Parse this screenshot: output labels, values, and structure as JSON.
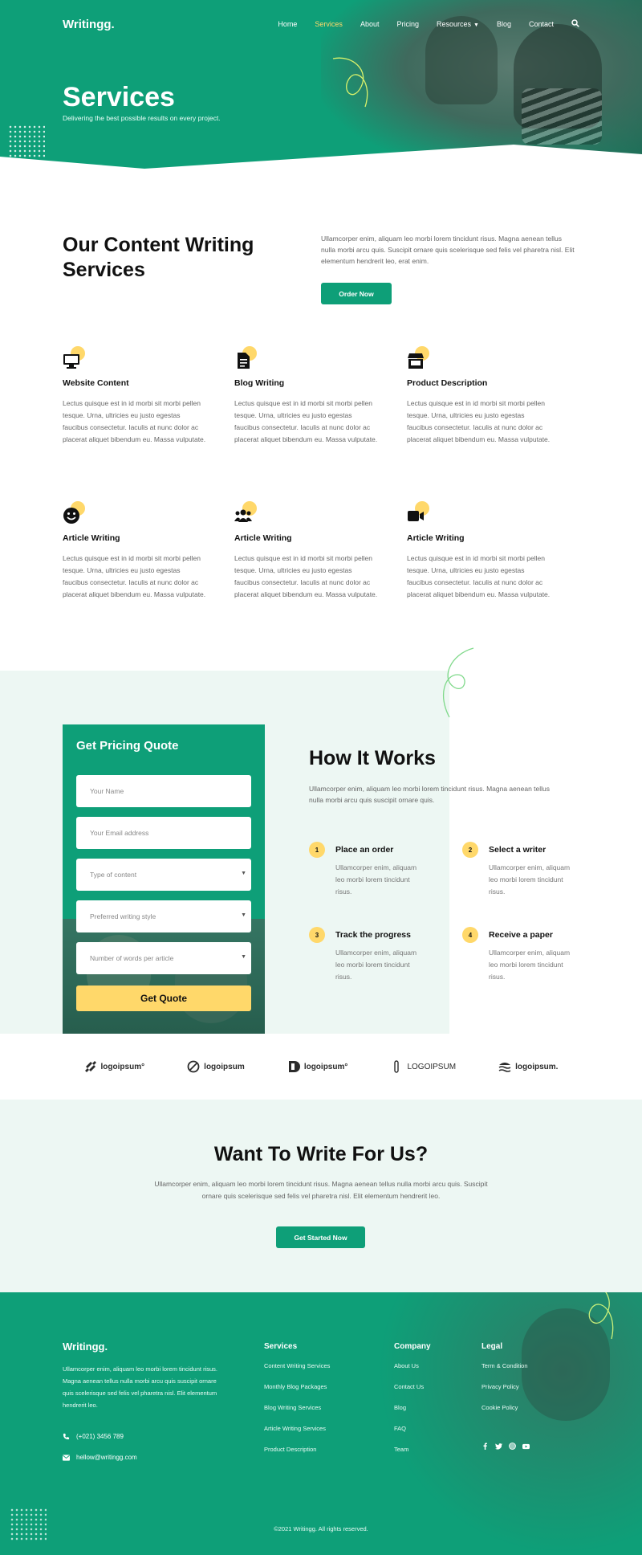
{
  "nav": {
    "logo": "Writingg.",
    "links": [
      "Home",
      "Services",
      "About",
      "Pricing",
      "Resources",
      "Blog",
      "Contact"
    ],
    "active": "Services"
  },
  "hero": {
    "title": "Services",
    "subtitle": "Delivering the best possible results on every project."
  },
  "intro": {
    "heading": "Our Content Writing Services",
    "text": "Ullamcorper enim, aliquam leo morbi lorem tincidunt risus. Magna aenean tellus nulla morbi arcu quis. Suscipit ornare quis scelerisque sed felis vel pharetra nisl. Elit elementum hendrerit leo, erat enim.",
    "button": "Order Now"
  },
  "services": [
    {
      "icon": "monitor-icon",
      "title": "Website Content",
      "text": "Lectus quisque est in id morbi sit morbi pellen tesque. Urna, ultricies eu justo egestas faucibus consectetur. Iaculis at nunc dolor ac placerat aliquet bibendum eu. Massa vulputate."
    },
    {
      "icon": "document-icon",
      "title": "Blog Writing",
      "text": "Lectus quisque est in id morbi sit morbi pellen tesque. Urna, ultricies eu justo egestas faucibus consectetur. Iaculis at nunc dolor ac placerat aliquet bibendum eu. Massa vulputate."
    },
    {
      "icon": "store-icon",
      "title": "Product Description",
      "text": "Lectus quisque est in id morbi sit morbi pellen tesque. Urna, ultricies eu justo egestas faucibus consectetur. Iaculis at nunc dolor ac placerat aliquet bibendum eu. Massa vulputate."
    },
    {
      "icon": "smile-icon",
      "title": "Article Writing",
      "text": "Lectus quisque est in id morbi sit morbi pellen tesque. Urna, ultricies eu justo egestas faucibus consectetur. Iaculis at nunc dolor ac placerat aliquet bibendum eu. Massa vulputate."
    },
    {
      "icon": "users-icon",
      "title": "Article Writing",
      "text": "Lectus quisque est in id morbi sit morbi pellen tesque. Urna, ultricies eu justo egestas faucibus consectetur. Iaculis at nunc dolor ac placerat aliquet bibendum eu. Massa vulputate."
    },
    {
      "icon": "video-icon",
      "title": "Article Writing",
      "text": "Lectus quisque est in id morbi sit morbi pellen tesque. Urna, ultricies eu justo egestas faucibus consectetur. Iaculis at nunc dolor ac placerat aliquet bibendum eu. Massa vulputate."
    }
  ],
  "quote": {
    "title": "Get Pricing Quote",
    "name_placeholder": "Your Name",
    "email_placeholder": "Your Email address",
    "content_select": "Type of content",
    "style_select": "Preferred writing style",
    "words_select": "Number of words per article",
    "button": "Get Quote"
  },
  "how": {
    "title": "How It Works",
    "lead": "Ullamcorper enim, aliquam leo morbi lorem tincidunt risus. Magna aenean tellus nulla morbi arcu quis suscipit ornare quis.",
    "steps": [
      {
        "num": "1",
        "title": "Place an order",
        "text": "Ullamcorper enim, aliquam leo morbi lorem tincidunt risus."
      },
      {
        "num": "2",
        "title": "Select a writer",
        "text": "Ullamcorper enim, aliquam leo morbi lorem tincidunt risus."
      },
      {
        "num": "3",
        "title": "Track the progress",
        "text": "Ullamcorper enim, aliquam leo morbi lorem tincidunt risus."
      },
      {
        "num": "4",
        "title": "Receive a paper",
        "text": "Ullamcorper enim, aliquam leo morbi lorem tincidunt risus."
      }
    ]
  },
  "logos": [
    "logoipsum°",
    "logoipsum",
    "logoipsum°",
    "LOGOIPSUM",
    "logoipsum."
  ],
  "write": {
    "title": "Want To Write For Us?",
    "text": "Ullamcorper enim, aliquam leo morbi lorem tincidunt risus. Magna aenean tellus nulla morbi arcu quis. Suscipit ornare quis scelerisque sed felis vel pharetra nisl. Elit elementum hendrerit leo.",
    "button": "Get Started Now"
  },
  "footer": {
    "logo": "Writingg.",
    "about": "Ullamcorper enim, aliquam leo morbi lorem tincidunt risus. Magna aenean tellus nulla morbi arcu quis suscipit ornare quis scelerisque sed felis vel pharetra nisl. Elit elementum hendrerit leo.",
    "phone": "(+021) 3456 789",
    "email": "hellow@writingg.com",
    "services_title": "Services",
    "services": [
      "Content Writing Services",
      "Monthly Blog Packages",
      "Blog Writing Services",
      "Article Writing Services",
      "Product Description"
    ],
    "company_title": "Company",
    "company": [
      "About Us",
      "Contact Us",
      "Blog",
      "FAQ",
      "Team"
    ],
    "legal_title": "Legal",
    "legal": [
      "Term & Condition",
      "Privacy Policy",
      "Cookie Policy"
    ],
    "social": [
      "facebook-icon",
      "twitter-icon",
      "dribbble-icon",
      "youtube-icon"
    ],
    "copyright": "©2021 Writingg. All rights reserved."
  },
  "colors": {
    "brand_green": "#0e9f78",
    "accent_yellow": "#ffd86a",
    "mint_bg": "#edf7f3"
  }
}
